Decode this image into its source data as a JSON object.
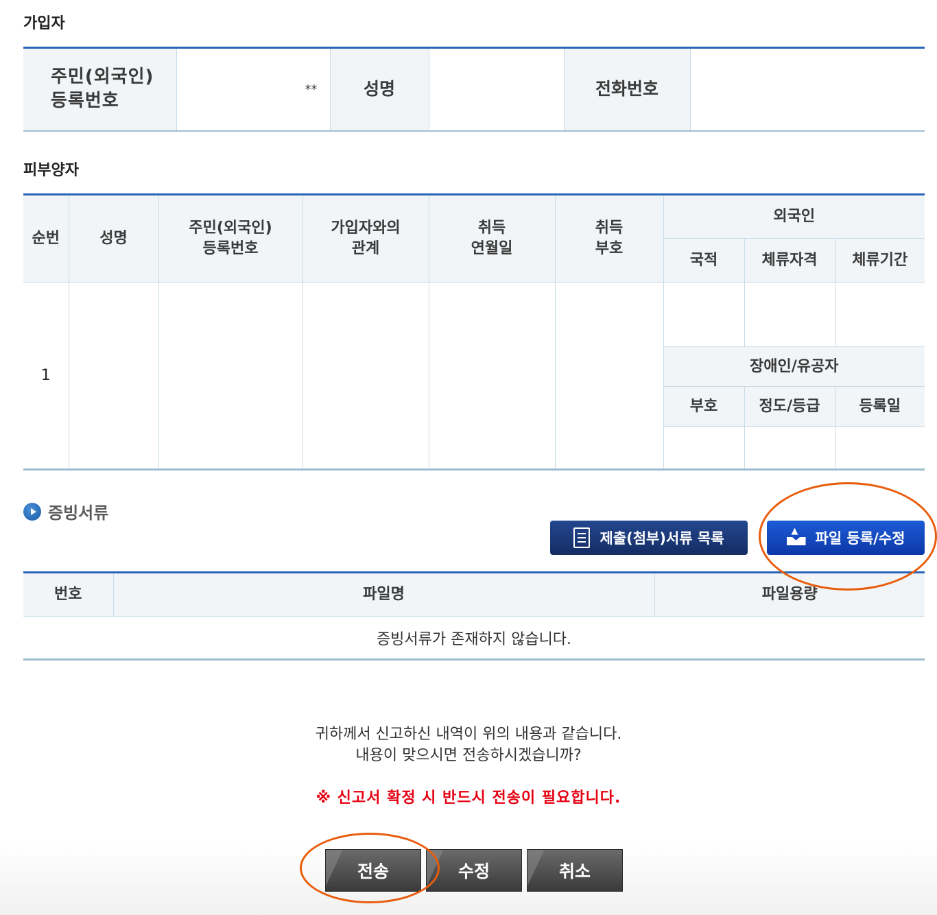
{
  "subscriber": {
    "title": "가입자",
    "rrn_label_1": "주민(외국인)",
    "rrn_label_2": "등록번호",
    "rrn_value": "**",
    "name_label": "성명",
    "phone_label": "전화번호"
  },
  "dependents": {
    "title": "피부양자",
    "headers": {
      "seq": "순번",
      "name": "성명",
      "rrn_1": "주민(외국인)",
      "rrn_2": "등록번호",
      "relation_1": "가입자와의",
      "relation_2": "관계",
      "acq_date_1": "취득",
      "acq_date_2": "연월일",
      "acq_code_1": "취득",
      "acq_code_2": "부호",
      "foreigner": "외국인",
      "nationality": "국적",
      "visa_status": "체류자격",
      "stay_period": "체류기간",
      "disabled": "장애인/유공자",
      "code": "부호",
      "grade": "정도/등급",
      "reg_date": "등록일"
    },
    "rows": [
      {
        "seq": "1"
      }
    ]
  },
  "documents": {
    "title": "증빙서류",
    "list_button": "제출(첨부)서류 목록",
    "file_button": "파일 등록/수정",
    "headers": {
      "no": "번호",
      "filename": "파일명",
      "filesize": "파일용량"
    },
    "empty_message": "증빙서류가 존재하지 않습니다."
  },
  "confirm": {
    "line1": "귀하께서 신고하신 내역이 위의 내용과 같습니다.",
    "line2": "내용이 맞으시면 전송하시겠습니까?",
    "warning": "※ 신고서 확정 시 반드시 전송이 필요합니다."
  },
  "actions": {
    "send": "전송",
    "edit": "수정",
    "cancel": "취소"
  },
  "colors": {
    "header_border": "#2a63b9",
    "annotation": "#e85d0c",
    "warning": "#e60012"
  }
}
